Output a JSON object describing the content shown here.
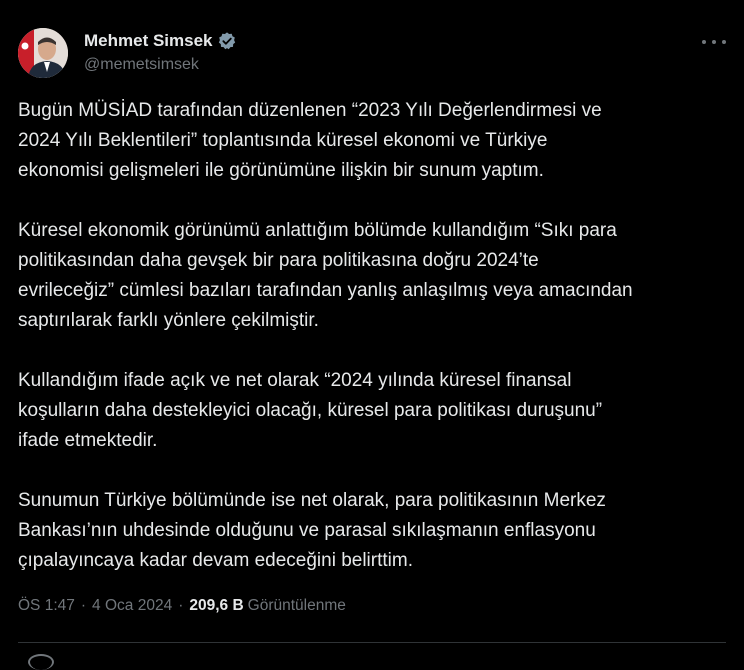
{
  "author": {
    "display_name": "Mehmet Simsek",
    "handle": "@memetsimsek",
    "verified": true,
    "avatar_icon": "profile-photo"
  },
  "tweet": {
    "paragraphs": [
      "Bugün MÜSİAD tarafından düzenlenen “2023 Yılı Değerlendirmesi ve\n2024 Yılı Beklentileri” toplantısında küresel ekonomi ve Türkiye\nekonomisi gelişmeleri ile görünümüne ilişkin bir sunum yaptım.",
      "Küresel ekonomik görünümü anlattığım bölümde kullandığım “Sıkı para\npolitikasından daha gevşek bir para politikasına doğru 2024’te\nevrileceğiz” cümlesi bazıları tarafından yanlış anlaşılmış veya amacından\nsaptırılarak farklı yönlere çekilmiştir.",
      "Kullandığım ifade açık ve net olarak “2024 yılında küresel finansal\nkoşulların daha destekleyici olacağı, küresel para politikası duruşunu”\nifade etmektedir.",
      "Sunumun Türkiye bölümünde ise net olarak, para politikasının Merkez\nBankası’nın uhdesinde olduğunu ve parasal sıkılaşmanın enflasyonu\nçıpalayıncaya kadar devam edeceğini belirttim."
    ],
    "time": "ÖS 1:47",
    "date": "4 Oca 2024",
    "separator": "·",
    "views_count": "209,6 B",
    "views_label": "Görüntülenme"
  },
  "colors": {
    "background": "#000000",
    "text": "#e7e9ea",
    "secondary": "#71767b",
    "verified_badge": "#829aab",
    "divider": "#2f3336"
  }
}
